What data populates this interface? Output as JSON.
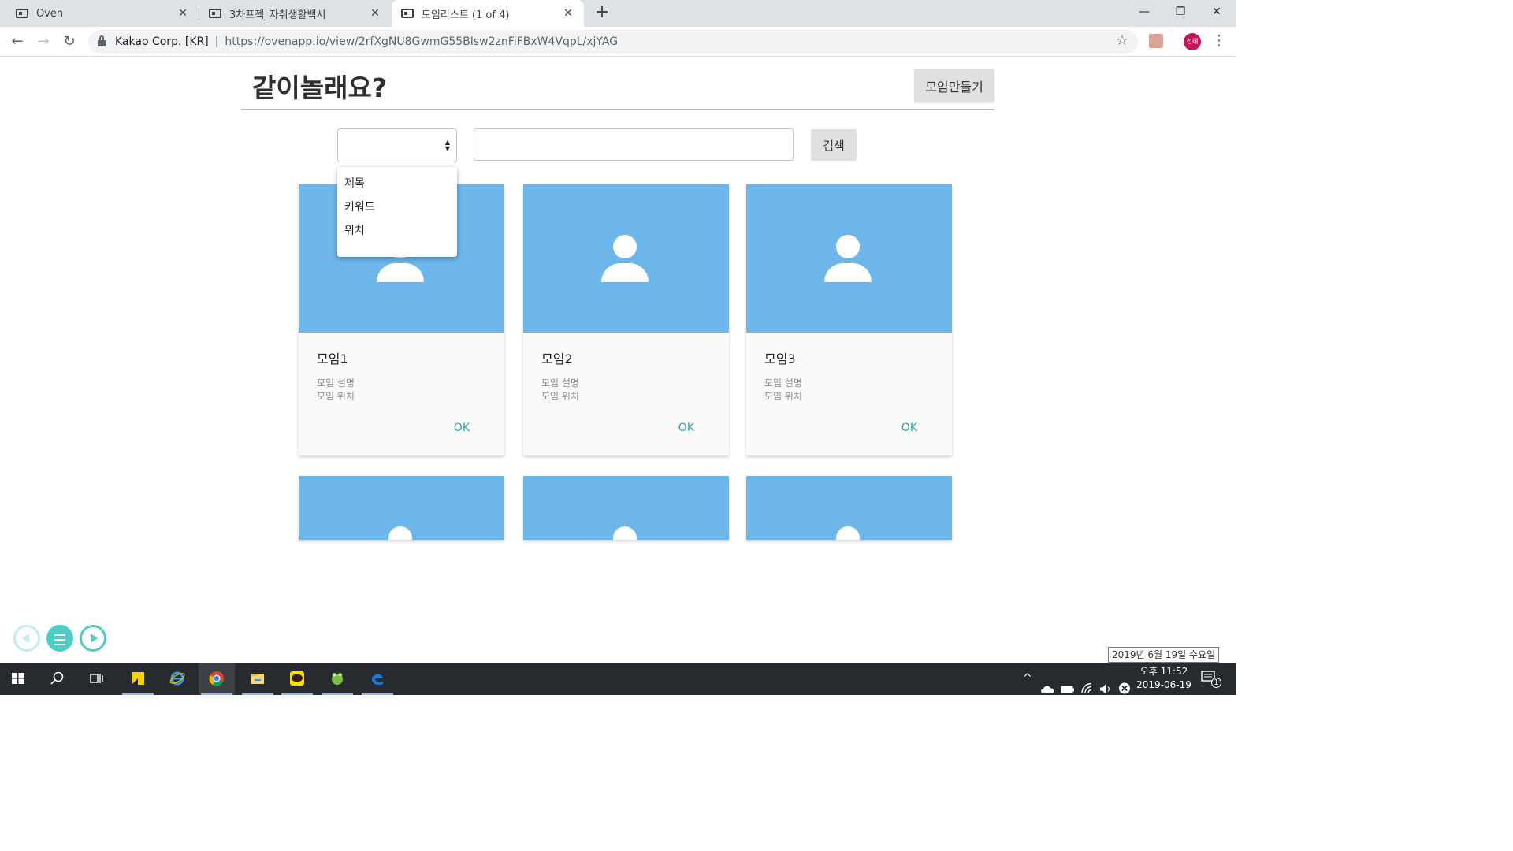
{
  "browser": {
    "tabs": [
      {
        "title": "Oven"
      },
      {
        "title": "3차프젝_자취생활백서"
      },
      {
        "title": "모임리스트 (1 of 4)"
      }
    ],
    "omnibox": {
      "org": "Kakao Corp. [KR]",
      "url": "https://ovenapp.io/view/2rfXgNU8GwmG55BIsw2znFiFBxW4VqpL/xjYAG"
    },
    "profile_initials": "선혜"
  },
  "page": {
    "title": "같이놀래요?",
    "create_label": "모임만들기",
    "search": {
      "select_options": [
        "제목",
        "키워드",
        "위치"
      ],
      "button_label": "검색",
      "input_value": ""
    },
    "cards": [
      {
        "title": "모임1",
        "desc": "모임 설명",
        "location": "모임 위치",
        "action": "OK"
      },
      {
        "title": "모임2",
        "desc": "모임 설명",
        "location": "모임 위치",
        "action": "OK"
      },
      {
        "title": "모임3",
        "desc": "모임 설명",
        "location": "모임 위치",
        "action": "OK"
      }
    ],
    "accent_color": "#6cb6ea",
    "ok_color": "#26a69a"
  },
  "tooltip": "2019년 6월 19일 수요일",
  "taskbar": {
    "time": "오후 11:52",
    "date": "2019-06-19",
    "notifications": "1"
  }
}
